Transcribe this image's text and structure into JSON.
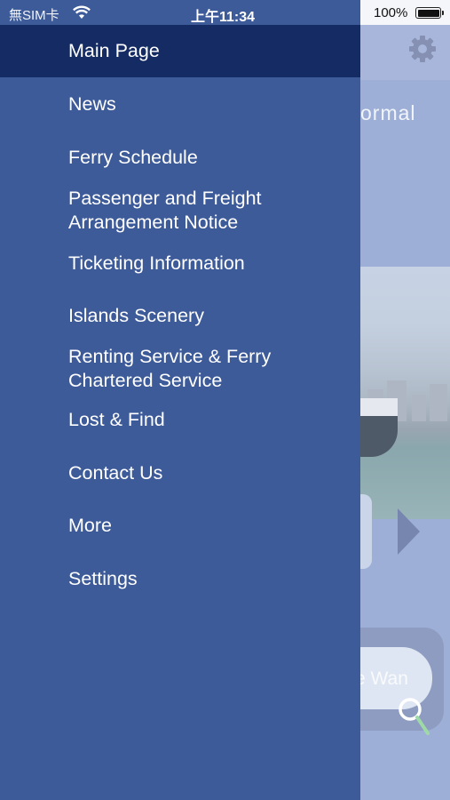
{
  "status_bar": {
    "carrier": "無SIM卡",
    "time": "上午11:34",
    "battery_percent": "100%"
  },
  "background": {
    "banner_text": "ormal",
    "search_text": "e Wan",
    "icons": [
      "gear-icon",
      "next-arrow-icon",
      "search-icon"
    ]
  },
  "drawer": {
    "items": [
      {
        "label": "Main Page",
        "active": true
      },
      {
        "label": "News",
        "active": false
      },
      {
        "label": "Ferry Schedule",
        "active": false
      },
      {
        "label": "Passenger and Freight\nArrangement Notice",
        "active": false
      },
      {
        "label": "Ticketing Information",
        "active": false
      },
      {
        "label": "Islands Scenery",
        "active": false
      },
      {
        "label": "Renting Service & Ferry\nChartered Service",
        "active": false
      },
      {
        "label": "Lost & Find",
        "active": false
      },
      {
        "label": "Contact Us",
        "active": false
      },
      {
        "label": "More",
        "active": false
      },
      {
        "label": "Settings",
        "active": false
      }
    ]
  },
  "colors": {
    "drawer_background": "#3d5a99",
    "drawer_active_item": "#142c63",
    "menu_text": "#ffffff"
  }
}
